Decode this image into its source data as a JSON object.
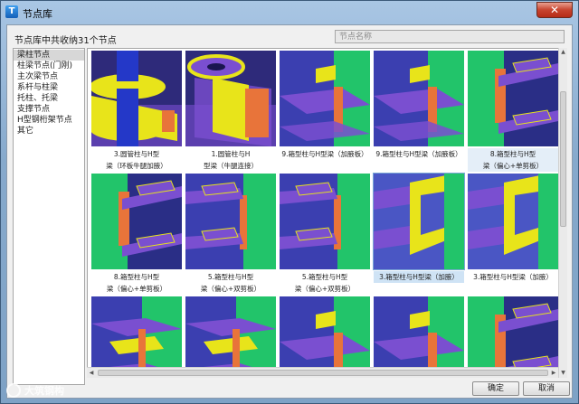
{
  "window": {
    "title": "节点库",
    "app_icon_glyph": "T",
    "close_glyph": "✕"
  },
  "library_info": "节点库中共收纳31个节点",
  "search": {
    "placeholder": "节点名称",
    "value": ""
  },
  "categories": [
    {
      "label": "梁柱节点",
      "selected": true
    },
    {
      "label": "柱梁节点(门刚)",
      "selected": false
    },
    {
      "label": "主次梁节点",
      "selected": false
    },
    {
      "label": "系杆与柱梁",
      "selected": false
    },
    {
      "label": "托柱、托梁",
      "selected": false
    },
    {
      "label": "支撑节点",
      "selected": false
    },
    {
      "label": "H型钢桁架节点",
      "selected": false
    },
    {
      "label": "其它",
      "selected": false
    }
  ],
  "nodes": [
    {
      "line1": "3.圆管柱与H型",
      "line2": "梁（环板牛腿加腋）",
      "icon": "round-column-ring-plate-icon"
    },
    {
      "line1": "1.圆管柱与H",
      "line2": "型梁（牛腿连接）",
      "icon": "round-column-bracket-icon"
    },
    {
      "line1": "9.箱型柱与H型梁（加腋板）",
      "line2": "",
      "icon": "box-column-haunch-icon"
    },
    {
      "line1": "9.箱型柱与H型梁（加腋板）",
      "line2": "",
      "icon": "box-column-haunch-icon"
    },
    {
      "line1": "8.箱型柱与H型",
      "line2": "梁（偏心+单剪板）",
      "icon": "box-column-shear-plate-icon"
    },
    {
      "line1": "8.箱型柱与H型",
      "line2": "梁（偏心+单剪板）",
      "icon": "box-column-shear-plate-icon"
    },
    {
      "line1": "5.箱型柱与H型",
      "line2": "梁（偏心+双剪板）",
      "icon": "box-column-double-shear-icon"
    },
    {
      "line1": "5.箱型柱与H型",
      "line2": "梁（偏心+双剪板）",
      "icon": "box-column-double-shear-icon"
    },
    {
      "line1": "3.箱型柱与H型梁（加腋）",
      "line2": "",
      "icon": "box-column-haunch-icon"
    },
    {
      "line1": "3.箱型柱与H型梁（加腋）",
      "line2": "",
      "icon": "box-column-haunch-icon"
    },
    {
      "line1": "",
      "line2": "",
      "icon": "box-column-joint-icon"
    },
    {
      "line1": "",
      "line2": "",
      "icon": "box-column-joint-icon"
    },
    {
      "line1": "",
      "line2": "",
      "icon": "box-column-joint-icon"
    },
    {
      "line1": "",
      "line2": "",
      "icon": "box-column-joint-icon"
    },
    {
      "line1": "",
      "line2": "",
      "icon": "box-column-joint-icon"
    }
  ],
  "selected_node_index": 8,
  "buttons": {
    "ok": "确定",
    "cancel": "取消"
  },
  "watermark": "大筑钢构",
  "colors": {
    "column_blue": "#2438c8",
    "plate_yellow": "#e8e41a",
    "stiffener_orange": "#e8743a",
    "beam_green": "#22c46a",
    "beam_purple": "#7a4fd0"
  }
}
